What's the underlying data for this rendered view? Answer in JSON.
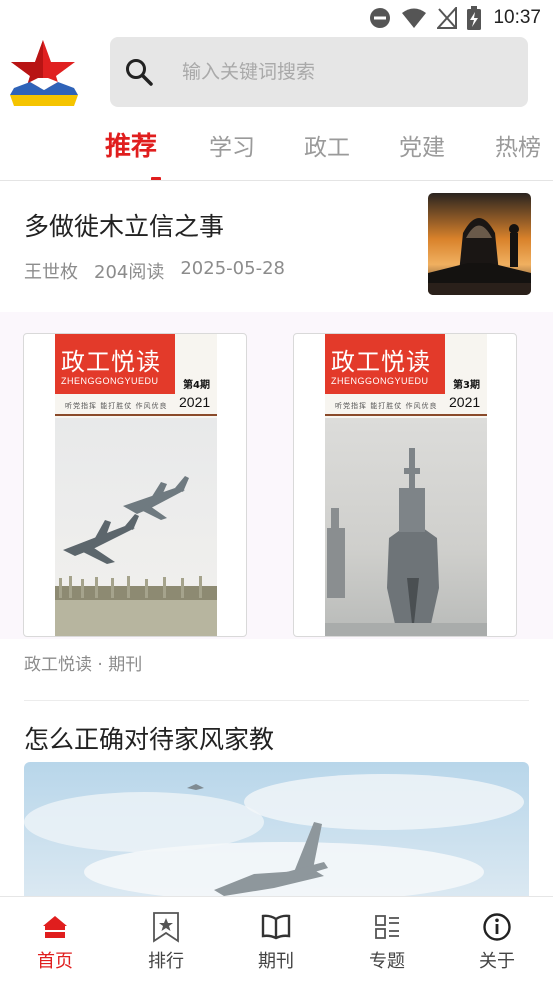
{
  "status_bar": {
    "time": "10:37"
  },
  "search": {
    "placeholder": "输入关键词搜索"
  },
  "tabs": [
    {
      "label": "推荐",
      "active": true
    },
    {
      "label": "学习"
    },
    {
      "label": "政工"
    },
    {
      "label": "党建"
    },
    {
      "label": "热榜"
    }
  ],
  "article1": {
    "title": "多做徙木立信之事",
    "author": "王世枚",
    "reads": "204阅读",
    "date": "2025-05-28"
  },
  "journals": {
    "items": [
      {
        "title": "政工悦读",
        "pinyin": "ZHENGGONGYUEDU",
        "issue": "第4期",
        "year": "2021",
        "slogan": "听党指挥  能打胜仗  作风优良",
        "photo": "fighter-jets-icon"
      },
      {
        "title": "政工悦读",
        "pinyin": "ZHENGGONGYUEDU",
        "issue": "第3期",
        "year": "2021",
        "slogan": "听党指挥  能打胜仗  作风优良",
        "photo": "warship-icon"
      }
    ],
    "caption": "政工悦读 · 期刊"
  },
  "article2": {
    "title": "怎么正确对待家风家教"
  },
  "bottom_nav": [
    {
      "label": "首页",
      "icon": "home-icon",
      "active": true
    },
    {
      "label": "排行",
      "icon": "ranking-icon"
    },
    {
      "label": "期刊",
      "icon": "book-icon"
    },
    {
      "label": "专题",
      "icon": "topics-icon"
    },
    {
      "label": "关于",
      "icon": "info-icon"
    }
  ],
  "colors": {
    "accent": "#e01e1e",
    "cover_red": "#e33a2a",
    "muted_text": "#8c8c8c"
  }
}
